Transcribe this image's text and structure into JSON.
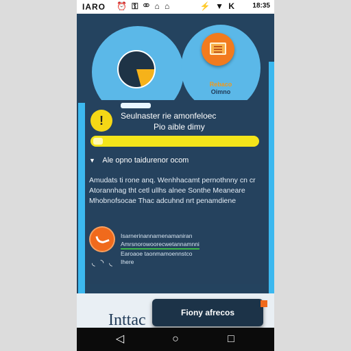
{
  "status_bar": {
    "left_text": "IARO",
    "icons": [
      "alarm-icon",
      "key-icon",
      "link-icon",
      "bag-icon",
      "bag-icon"
    ],
    "signal_icons": [
      "wifi-icon",
      "battery-icon"
    ],
    "time": "18:35"
  },
  "hero": {
    "left_icon": "pie-chart-icon",
    "app_icon": "document-icon",
    "app_name_line1": "Rebaco",
    "app_name_line2": "Oimno"
  },
  "card": {
    "title_line1": "Seulnaster rie amonfeloec",
    "title_line2": "Pio aible dimy",
    "progress_value": 1.0,
    "section_label": "Ale opno taidurenor ocom",
    "body_lines": [
      "Amudats ti rone anq. Wenhhacamt pernothnny cn cr",
      "Atorannhag tht cetl ullhs alnee Sonthe Meaneare",
      "Mhobnofsocae Thac adcuhnd nrt penamdiene"
    ],
    "list_lines": [
      "Isarnerinannarnenamaniran",
      "Amrsnorowoorecwetannamnni",
      "Earoaoe taonmamoennstco",
      "Ihere"
    ]
  },
  "footer": {
    "brand": "Inttac",
    "toast_label": "Fiony afrecos"
  },
  "colors": {
    "background": "#24435f",
    "accent_blue": "#3cb8ef",
    "accent_yellow": "#f4e51a",
    "accent_orange": "#f06a1c"
  },
  "nav": {
    "back_icon": "back-triangle-icon",
    "home_icon": "home-circle-icon",
    "recents_icon": "recents-square-icon"
  }
}
